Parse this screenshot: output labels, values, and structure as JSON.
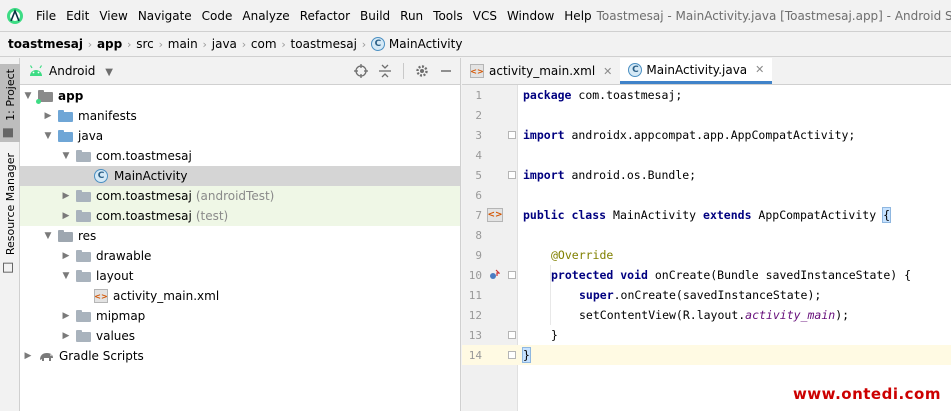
{
  "menubar": {
    "items": [
      "File",
      "Edit",
      "View",
      "Navigate",
      "Code",
      "Analyze",
      "Refactor",
      "Build",
      "Run",
      "Tools",
      "VCS",
      "Window",
      "Help"
    ],
    "window_title": "Toastmesaj - MainActivity.java [Toastmesaj.app] - Android Studio"
  },
  "breadcrumb": {
    "items": [
      "toastmesaj",
      "app",
      "src",
      "main",
      "java",
      "com",
      "toastmesaj",
      "MainActivity"
    ],
    "class_badge": "C"
  },
  "sidestrip": {
    "project_tab": "1: Project",
    "resource_tab": "Resource Manager"
  },
  "project_panel": {
    "view_label": "Android",
    "tree": [
      {
        "label": "app",
        "extra": ""
      },
      {
        "label": "manifests",
        "extra": ""
      },
      {
        "label": "java",
        "extra": ""
      },
      {
        "label": "com.toastmesaj",
        "extra": ""
      },
      {
        "label": "MainActivity",
        "extra": ""
      },
      {
        "label": "com.toastmesaj",
        "extra": "(androidTest)"
      },
      {
        "label": "com.toastmesaj",
        "extra": "(test)"
      },
      {
        "label": "res",
        "extra": ""
      },
      {
        "label": "drawable",
        "extra": ""
      },
      {
        "label": "layout",
        "extra": ""
      },
      {
        "label": "activity_main.xml",
        "extra": ""
      },
      {
        "label": "mipmap",
        "extra": ""
      },
      {
        "label": "values",
        "extra": ""
      },
      {
        "label": "Gradle Scripts",
        "extra": ""
      }
    ]
  },
  "editor": {
    "tabs": [
      {
        "label": "activity_main.xml",
        "active": false
      },
      {
        "label": "MainActivity.java",
        "active": true
      }
    ],
    "line_numbers": [
      "1",
      "2",
      "3",
      "4",
      "5",
      "6",
      "7",
      "8",
      "9",
      "10",
      "11",
      "12",
      "13",
      "14"
    ],
    "lines": {
      "l1_kw": "package",
      "l1_rest": " com.toastmesaj;",
      "l3_kw": "import",
      "l3_rest": " androidx.appcompat.app.AppCompatActivity;",
      "l5_kw": "import",
      "l5_rest": " android.os.Bundle;",
      "l7_kw1": "public class",
      "l7_name": " MainActivity ",
      "l7_kw2": "extends",
      "l7_super": " AppCompatActivity ",
      "l7_brace": "{",
      "l9_ann": "@Override",
      "l10_kw": "protected void",
      "l10_rest": " onCreate(Bundle savedInstanceState) {",
      "l11_kw": "super",
      "l11_rest": ".onCreate(savedInstanceState);",
      "l12_a": "setContentView(R.layout.",
      "l12_field": "activity_main",
      "l12_b": ");",
      "l13": "}",
      "l14": "}"
    }
  },
  "watermark": "www.ontedi.com",
  "colors": {
    "keyword": "#000080",
    "annotation": "#808000",
    "field": "#660e7a",
    "accent": "#4083c9",
    "watermark": "#cc0000"
  }
}
